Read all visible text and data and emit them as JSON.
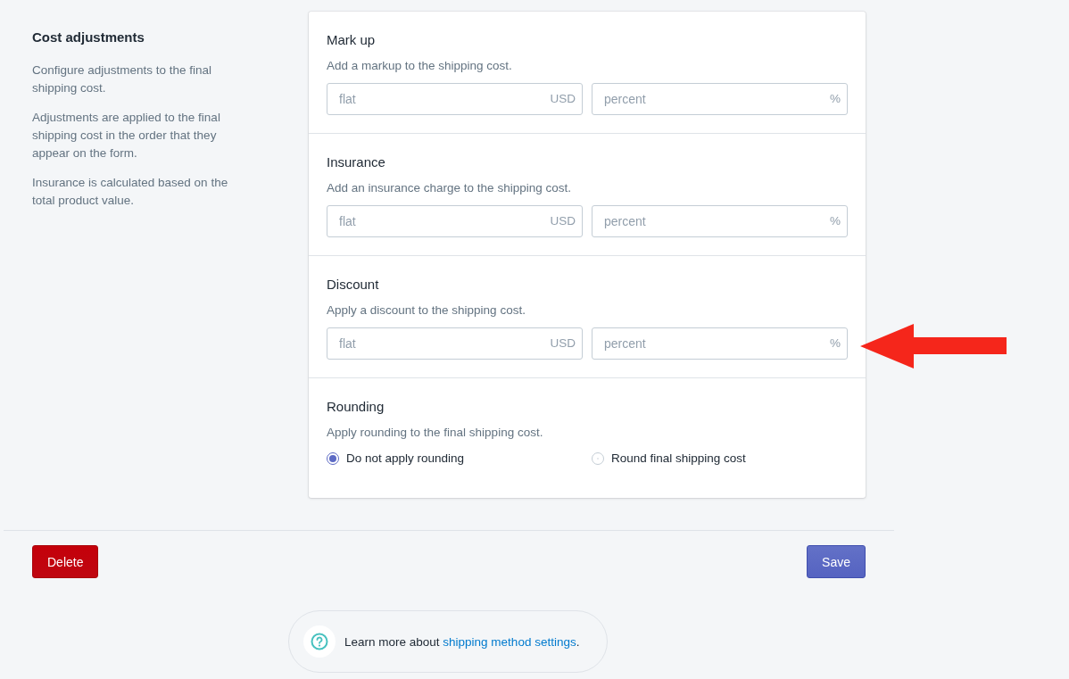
{
  "aside": {
    "title": "Cost adjustments",
    "paragraphs": [
      "Configure adjustments to the final shipping cost.",
      "Adjustments are applied to the final shipping cost in the order that they appear on the form.",
      "Insurance is calculated based on the total product value."
    ]
  },
  "sections": [
    {
      "kind": "fields",
      "title": "Mark up",
      "description": "Add a markup to the shipping cost.",
      "fields": [
        {
          "placeholder": "flat",
          "suffix": "USD"
        },
        {
          "placeholder": "percent",
          "suffix": "%"
        }
      ]
    },
    {
      "kind": "fields",
      "title": "Insurance",
      "description": "Add an insurance charge to the shipping cost.",
      "fields": [
        {
          "placeholder": "flat",
          "suffix": "USD"
        },
        {
          "placeholder": "percent",
          "suffix": "%"
        }
      ]
    },
    {
      "kind": "fields",
      "title": "Discount",
      "description": "Apply a discount to the shipping cost.",
      "fields": [
        {
          "placeholder": "flat",
          "suffix": "USD"
        },
        {
          "placeholder": "percent",
          "suffix": "%"
        }
      ],
      "annotated": true
    },
    {
      "kind": "radios",
      "title": "Rounding",
      "description": "Apply rounding to the final shipping cost.",
      "options": [
        {
          "label": "Do not apply rounding",
          "selected": true
        },
        {
          "label": "Round final shipping cost",
          "selected": false
        }
      ]
    }
  ],
  "actions": {
    "delete": "Delete",
    "save": "Save"
  },
  "help": {
    "prefix": "Learn more about ",
    "link": "shipping method settings",
    "suffix": "."
  }
}
